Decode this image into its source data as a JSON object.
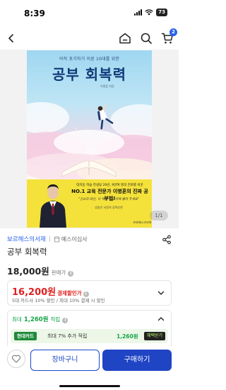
{
  "status_bar": {
    "time": "8:39",
    "battery": "73"
  },
  "nav": {
    "cart_count": "2"
  },
  "book_cover": {
    "subtitle": "아직 포기하기 이른 10대를 위한",
    "title": "공부 회복력",
    "author": "이병훈 지음",
    "banner_line1": "대치동 학습 컨설팅 20년, 9만여 명의 진로를 바꾼",
    "banner_line2": "NO.1 교육 전문가 이병훈의 진짜 공부법!",
    "banner_line3": "\"선소리 대신, 이 책을 책상 위에 올려 두세요\"",
    "banner_line4": "방송인 서정석 강력추천",
    "publisher": "보레헤스의서재"
  },
  "gallery": {
    "page_indicator": "1/1"
  },
  "product": {
    "seller": "보르헤스의서재",
    "seller_badge": "예스이십사",
    "title": "공부 회복력",
    "list_price": "18,000원",
    "list_price_label": "판매가",
    "sale_price": "16,200원",
    "sale_label": "결제할인가",
    "sale_sub": "5대 카드사 10% 할인 / 최대 10% 결제 시 할인",
    "points_label": "최대",
    "points_value": "1,260원",
    "points_suffix": "적립",
    "card_badge": "현대카드",
    "card_text": "최대 7% 추가 적립",
    "card_amount": "1,260원",
    "card_button": "혜택받기"
  },
  "actions": {
    "cart_label": "장바구니",
    "buy_label": "구매하기"
  },
  "colors": {
    "accent_blue": "#1f44c4",
    "sale_red": "#e02020",
    "points_green": "#16a34a",
    "banner_yellow": "#f4e23a"
  }
}
